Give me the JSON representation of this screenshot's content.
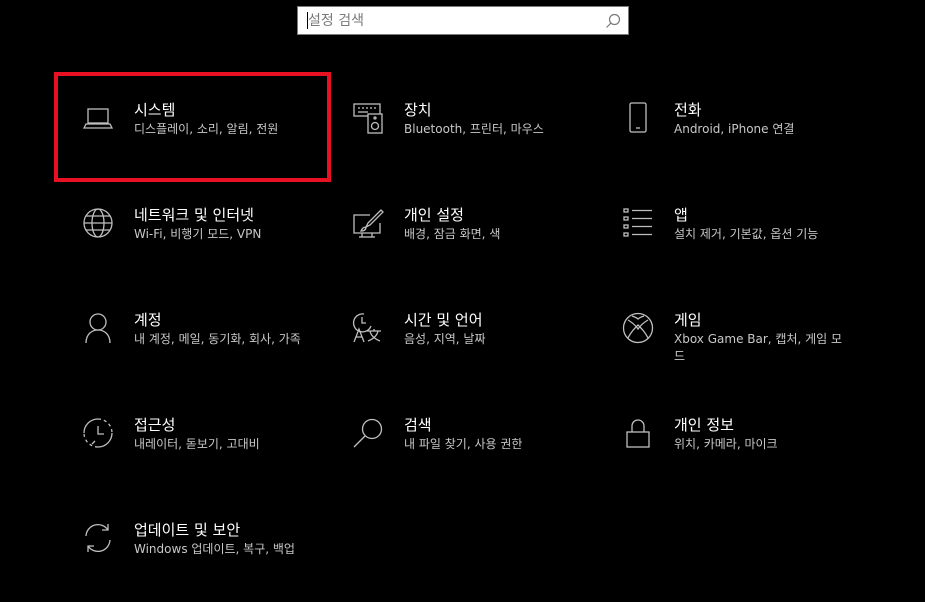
{
  "search": {
    "placeholder": "설정 검색",
    "icon": "search-icon"
  },
  "accent": {
    "highlight_color": "#e81123"
  },
  "tiles": [
    {
      "title": "시스템",
      "desc": "디스플레이, 소리, 알림, 전원",
      "icon": "laptop-icon"
    },
    {
      "title": "장치",
      "desc": "Bluetooth, 프린터, 마우스",
      "icon": "devices-icon"
    },
    {
      "title": "전화",
      "desc": "Android, iPhone 연결",
      "icon": "phone-icon"
    },
    {
      "title": "네트워크 및 인터넷",
      "desc": "Wi-Fi, 비행기 모드, VPN",
      "icon": "globe-icon"
    },
    {
      "title": "개인 설정",
      "desc": "배경, 잠금 화면, 색",
      "icon": "personalization-icon"
    },
    {
      "title": "앱",
      "desc": "설치 제거, 기본값, 옵션 기능",
      "icon": "apps-list-icon"
    },
    {
      "title": "계정",
      "desc": "내 계정, 메일, 동기화, 회사, 가족",
      "icon": "person-icon"
    },
    {
      "title": "시간 및 언어",
      "desc": "음성, 지역, 날짜",
      "icon": "time-language-icon"
    },
    {
      "title": "게임",
      "desc": "Xbox Game Bar, 캡처, 게임 모드",
      "icon": "xbox-icon"
    },
    {
      "title": "접근성",
      "desc": "내레이터, 돋보기, 고대비",
      "icon": "ease-of-access-icon"
    },
    {
      "title": "검색",
      "desc": "내 파일 찾기, 사용 권한",
      "icon": "search-icon"
    },
    {
      "title": "개인 정보",
      "desc": "위치, 카메라, 마이크",
      "icon": "lock-icon"
    },
    {
      "title": "업데이트 및 보안",
      "desc": "Windows 업데이트, 복구, 백업",
      "icon": "update-sync-icon"
    }
  ]
}
